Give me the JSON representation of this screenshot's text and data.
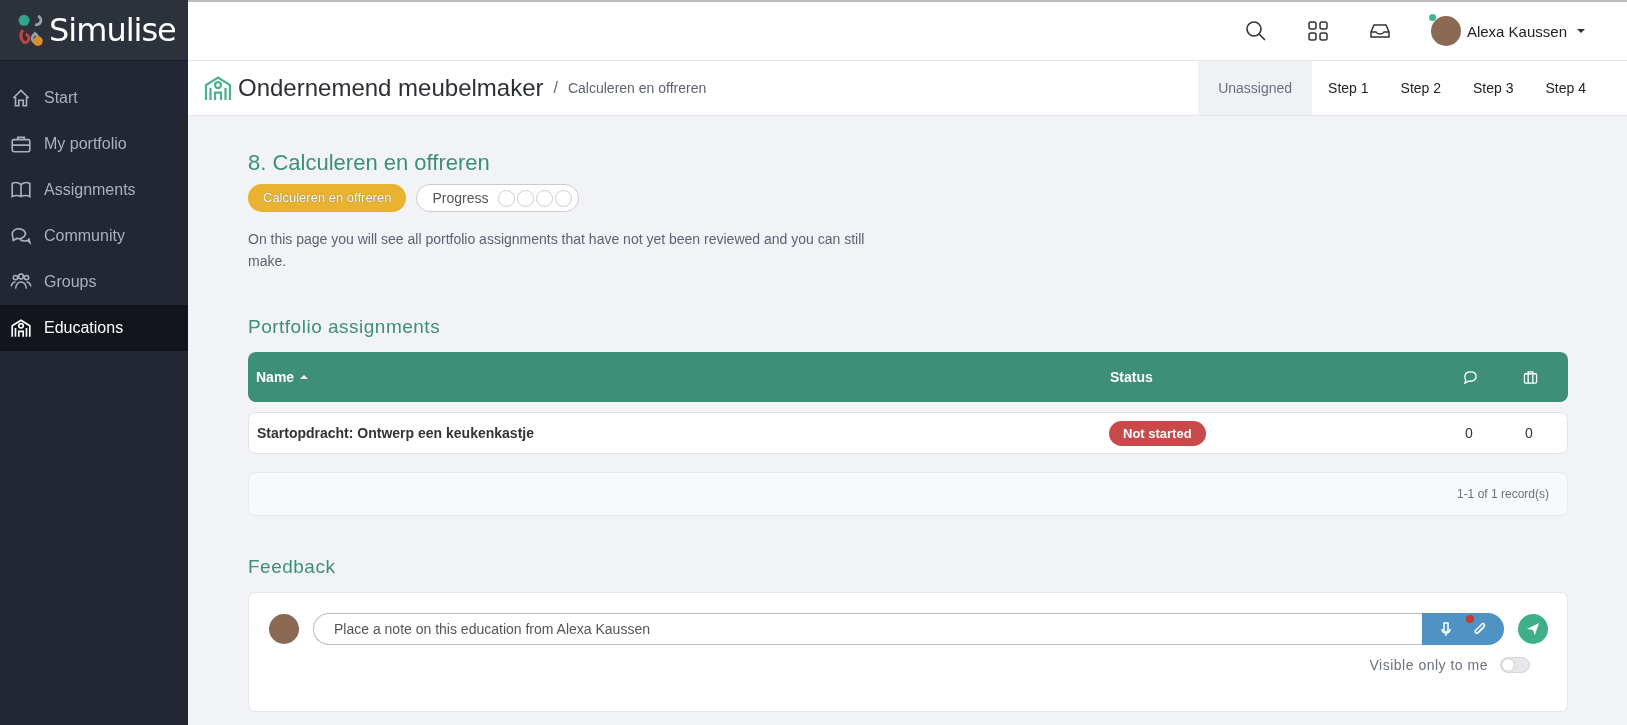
{
  "logo": {
    "text": "Simulise"
  },
  "sidebar": {
    "items": [
      {
        "label": "Start",
        "selected": false
      },
      {
        "label": "My portfolio",
        "selected": false
      },
      {
        "label": "Assignments",
        "selected": false
      },
      {
        "label": "Community",
        "selected": false
      },
      {
        "label": "Groups",
        "selected": false
      },
      {
        "label": "Educations",
        "selected": true
      }
    ]
  },
  "header": {
    "user": {
      "name": "Alexa Kaussen",
      "online": true
    }
  },
  "breadcrumb": {
    "title": "Ondernemend meubelmaker",
    "separator": "/",
    "current": "Calculeren en offreren"
  },
  "steps": [
    {
      "label": "Unassigned",
      "selected": true
    },
    {
      "label": "Step 1",
      "selected": false
    },
    {
      "label": "Step 2",
      "selected": false
    },
    {
      "label": "Step 3",
      "selected": false
    },
    {
      "label": "Step 4",
      "selected": false
    }
  ],
  "page": {
    "heading": "8. Calculeren en offreren",
    "tag": "Calculeren en offreren",
    "progress": {
      "label": "Progress",
      "steps": [
        {
          "done": false
        },
        {
          "done": false
        },
        {
          "done": false
        },
        {
          "done": false
        }
      ]
    },
    "description": "On this page you will see all portfolio assignments that have not yet been reviewed and you can still make."
  },
  "assignments": {
    "title": "Portfolio assignments",
    "columns": [
      {
        "label": "Name",
        "sorted": true
      },
      {
        "label": "Status",
        "sorted": false
      }
    ],
    "rows": [
      {
        "name": "Startopdracht: Ontwerp een keukenkastje",
        "status": {
          "text": "Not started",
          "kind": "not-started"
        },
        "comments": "0",
        "portfolio": "0"
      }
    ],
    "footer": "1-1 of 1 record(s)"
  },
  "feedback": {
    "title": "Feedback",
    "placeholder": "Place a note on this education from Alexa Kaussen",
    "attachment_badge": true,
    "visible_only_label": "Visible only to me",
    "visible_only": false
  }
}
